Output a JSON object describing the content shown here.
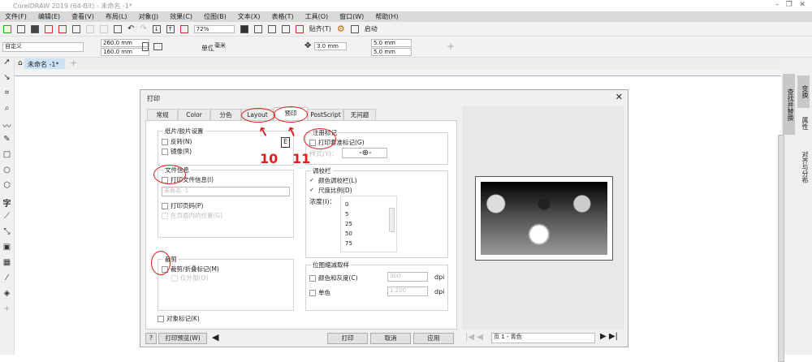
{
  "window": {
    "title": "CorelDRAW 2019 (64-Bit) - 未命名 -1*"
  },
  "menu": [
    "文件(F)",
    "编辑(E)",
    "查看(V)",
    "布局(L)",
    "对象(J)",
    "效果(C)",
    "位图(B)",
    "文本(X)",
    "表格(T)",
    "工具(O)",
    "窗口(W)",
    "帮助(H)"
  ],
  "toolbar": {
    "zoom": "72%",
    "snap": "贴齐(T)",
    "launch": "启动"
  },
  "propbar": {
    "preset": "自定义",
    "width": "260.0 mm",
    "height": "160.0 mm",
    "units_label": "单位：",
    "units": "毫米",
    "nudge": "3.0 mm",
    "dup_x": "5.0 mm",
    "dup_y": "5.0 mm"
  },
  "doc_tab": "未命名 -1*",
  "right_dock": [
    "查找并替换",
    "变换",
    "属性",
    "对齐与分布"
  ],
  "dialog": {
    "title": "打印",
    "tabs": [
      "常规",
      "Color",
      "分色",
      "Layout",
      "预印",
      "PostScript",
      "无问题"
    ],
    "active_tab": "预印",
    "paper": {
      "title": "纸片/胶片设置",
      "invert": "反转(N)",
      "mirror": "镜像(R)"
    },
    "fileinfo": {
      "title": "文件信息",
      "print_info": "打印文件信息(I)",
      "filename": "未命名 -1",
      "page_num": "打印页码(P)",
      "in_page": "在页面内的位置(G)"
    },
    "crop": {
      "title": "裁剪",
      "marks": "裁剪/折叠标记(M)",
      "outside": "仅外部(O)"
    },
    "object_marks": "对象标记(K)",
    "registration": {
      "title": "注册标记",
      "print": "打印套准标记(G)",
      "style": "样式(Y)："
    },
    "calib": {
      "title": "调校栏",
      "color_bar": "颜色调校栏(L)",
      "density_scale": "尺度比例(D)",
      "density_label": "浓度(I)：",
      "densities": [
        "0",
        "5",
        "25",
        "50",
        "75"
      ]
    },
    "downsample": {
      "title": "位图缩减取样",
      "color": "颜色和灰度(C)",
      "color_dpi": "300",
      "mono": "单色",
      "mono_dpi": "1,200",
      "unit": "dpi"
    },
    "buttons": {
      "help": "?",
      "preview": "打印预览(W)",
      "print": "打印",
      "cancel": "取消",
      "apply": "应用"
    },
    "page_select": "页 1 - 青色"
  },
  "annotations": {
    "a10": "10",
    "a11": "11"
  }
}
